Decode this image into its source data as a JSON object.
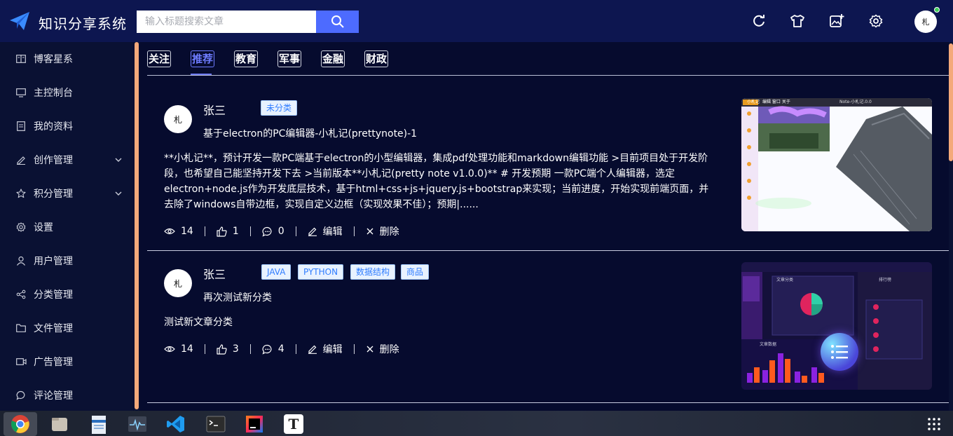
{
  "header": {
    "app_title": "知识分享系统",
    "search_placeholder": "输入标题搜索文章",
    "avatar_text": "札"
  },
  "sidebar": {
    "items": [
      {
        "label": "博客星系",
        "icon": "book-icon"
      },
      {
        "label": "主控制台",
        "icon": "monitor-icon"
      },
      {
        "label": "我的资料",
        "icon": "profile-card-icon"
      },
      {
        "label": "创作管理",
        "icon": "edit-icon",
        "expandable": true
      },
      {
        "label": "积分管理",
        "icon": "star-icon",
        "expandable": true
      },
      {
        "label": "设置",
        "icon": "gear-icon"
      },
      {
        "label": "用户管理",
        "icon": "user-icon"
      },
      {
        "label": "分类管理",
        "icon": "share-icon"
      },
      {
        "label": "文件管理",
        "icon": "folder-icon"
      },
      {
        "label": "广告管理",
        "icon": "video-icon"
      },
      {
        "label": "评论管理",
        "icon": "comment-icon"
      }
    ]
  },
  "tabs": [
    {
      "label": "关注",
      "active": false
    },
    {
      "label": "推荐",
      "active": true
    },
    {
      "label": "教育",
      "active": false
    },
    {
      "label": "军事",
      "active": false
    },
    {
      "label": "金融",
      "active": false
    },
    {
      "label": "财政",
      "active": false
    }
  ],
  "articles": [
    {
      "author": "张三",
      "avatar_text": "札",
      "tags": [
        "未分类"
      ],
      "title": "基于electron的PC编辑器-小札记(prettynote)-1",
      "summary": "**小札记**，预计开发一款PC端基于electron的小型编辑器，集成pdf处理功能和markdown编辑功能 >目前项目处于开发阶段，也希望自己能坚持开发下去 >当前版本**小札记(pretty note v1.0.0)** # 开发预期 一款PC端个人编辑器，选定electron+node.js作为开发底层技术，基于html+css+js+jquery.js+bootstrap来实现；当前进度，开始实现前端页面，并去除了windows自带边框，实现自定义边框（实现效果不佳）；预期|......",
      "views": "14",
      "likes": "1",
      "comments": "0",
      "edit_label": "编辑",
      "delete_label": "删除",
      "thumb_window_title": "小札记",
      "thumb_window_menu": "编辑 窗口 关于",
      "thumb_window_file": "Note-小札记.0.0"
    },
    {
      "author": "张三",
      "avatar_text": "札",
      "tags": [
        "JAVA",
        "PYTHON",
        "数据结构",
        "商品"
      ],
      "title": "再次测试新分类",
      "summary": "测试新文章分类",
      "views": "14",
      "likes": "3",
      "comments": "4",
      "edit_label": "编辑",
      "delete_label": "删除",
      "thumb_panel_left": "文章分类",
      "thumb_panel_right": "排行榜",
      "thumb_panel_bottom": "文章数据"
    }
  ],
  "colors": {
    "header_bg": "#0d1650",
    "page_bg": "#060b2e",
    "accent": "#4d6bff",
    "active_tab": "#6e7cff",
    "tag_text": "#2f7dff",
    "scroll_thumb": "#f4a97a"
  },
  "taskbar": {
    "apps": [
      "chrome-icon",
      "files-icon",
      "document-viewer-icon",
      "system-monitor-icon",
      "vscode-icon",
      "terminal-icon",
      "intellij-icon",
      "typora-icon"
    ],
    "typora_letter": "T"
  }
}
